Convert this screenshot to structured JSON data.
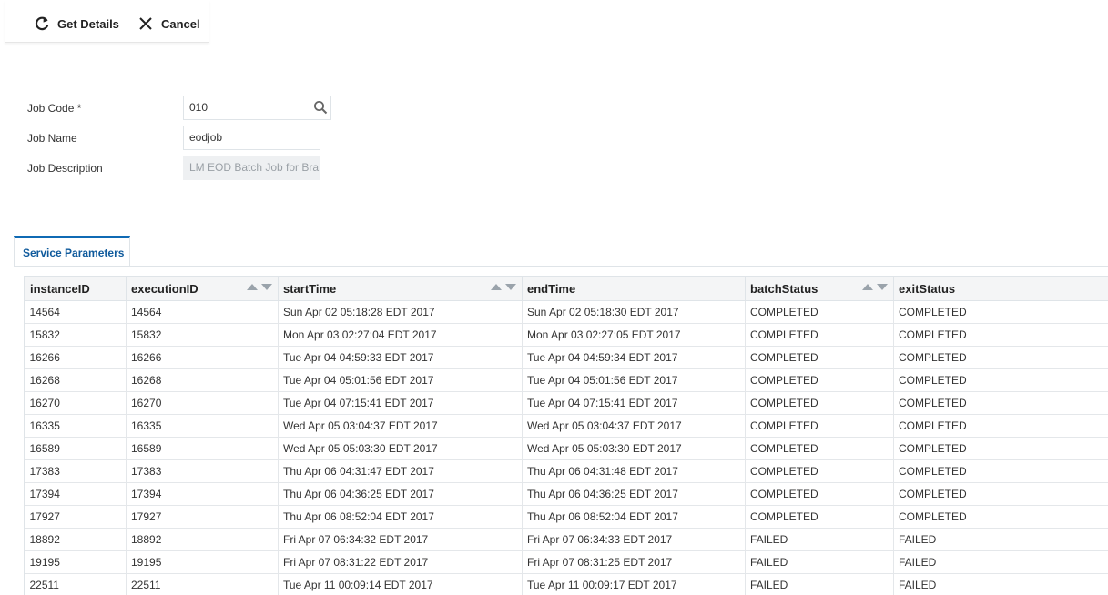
{
  "toolbar": {
    "get_details_label": "Get Details",
    "cancel_label": "Cancel"
  },
  "form": {
    "job_code_label": "Job Code *",
    "job_code_value": "010",
    "job_name_label": "Job Name",
    "job_name_value": "eodjob",
    "job_desc_label": "Job Description",
    "job_desc_value": "LM EOD Batch Job for Bra"
  },
  "tabs": [
    {
      "label": "Service Parameters",
      "active": true
    }
  ],
  "grid": {
    "columns": [
      {
        "label": "instanceID",
        "sortable": false
      },
      {
        "label": "executionID",
        "sortable": true
      },
      {
        "label": "startTime",
        "sortable": true
      },
      {
        "label": "endTime",
        "sortable": false
      },
      {
        "label": "batchStatus",
        "sortable": true
      },
      {
        "label": "exitStatus",
        "sortable": false
      }
    ],
    "rows": [
      [
        "14564",
        "14564",
        "Sun Apr 02 05:18:28 EDT 2017",
        "Sun Apr 02 05:18:30 EDT 2017",
        "COMPLETED",
        "COMPLETED"
      ],
      [
        "15832",
        "15832",
        "Mon Apr 03 02:27:04 EDT 2017",
        "Mon Apr 03 02:27:05 EDT 2017",
        "COMPLETED",
        "COMPLETED"
      ],
      [
        "16266",
        "16266",
        "Tue Apr 04 04:59:33 EDT 2017",
        "Tue Apr 04 04:59:34 EDT 2017",
        "COMPLETED",
        "COMPLETED"
      ],
      [
        "16268",
        "16268",
        "Tue Apr 04 05:01:56 EDT 2017",
        "Tue Apr 04 05:01:56 EDT 2017",
        "COMPLETED",
        "COMPLETED"
      ],
      [
        "16270",
        "16270",
        "Tue Apr 04 07:15:41 EDT 2017",
        "Tue Apr 04 07:15:41 EDT 2017",
        "COMPLETED",
        "COMPLETED"
      ],
      [
        "16335",
        "16335",
        "Wed Apr 05 03:04:37 EDT 2017",
        "Wed Apr 05 03:04:37 EDT 2017",
        "COMPLETED",
        "COMPLETED"
      ],
      [
        "16589",
        "16589",
        "Wed Apr 05 05:03:30 EDT 2017",
        "Wed Apr 05 05:03:30 EDT 2017",
        "COMPLETED",
        "COMPLETED"
      ],
      [
        "17383",
        "17383",
        "Thu Apr 06 04:31:47 EDT 2017",
        "Thu Apr 06 04:31:48 EDT 2017",
        "COMPLETED",
        "COMPLETED"
      ],
      [
        "17394",
        "17394",
        "Thu Apr 06 04:36:25 EDT 2017",
        "Thu Apr 06 04:36:25 EDT 2017",
        "COMPLETED",
        "COMPLETED"
      ],
      [
        "17927",
        "17927",
        "Thu Apr 06 08:52:04 EDT 2017",
        "Thu Apr 06 08:52:04 EDT 2017",
        "COMPLETED",
        "COMPLETED"
      ],
      [
        "18892",
        "18892",
        "Fri Apr 07 06:34:32 EDT 2017",
        "Fri Apr 07 06:34:33 EDT 2017",
        "FAILED",
        "FAILED"
      ],
      [
        "19195",
        "19195",
        "Fri Apr 07 08:31:22 EDT 2017",
        "Fri Apr 07 08:31:25 EDT 2017",
        "FAILED",
        "FAILED"
      ],
      [
        "22511",
        "22511",
        "Tue Apr 11 00:09:14 EDT 2017",
        "Tue Apr 11 00:09:17 EDT 2017",
        "FAILED",
        "FAILED"
      ]
    ]
  },
  "icons": {
    "refresh": "refresh-icon",
    "close": "close-icon",
    "search": "search-icon",
    "sort": "sort-arrows-icon"
  },
  "colors": {
    "accent": "#0f6ab4",
    "header_bg": "#f4f5f6",
    "readonly_bg": "#eef0f2"
  }
}
